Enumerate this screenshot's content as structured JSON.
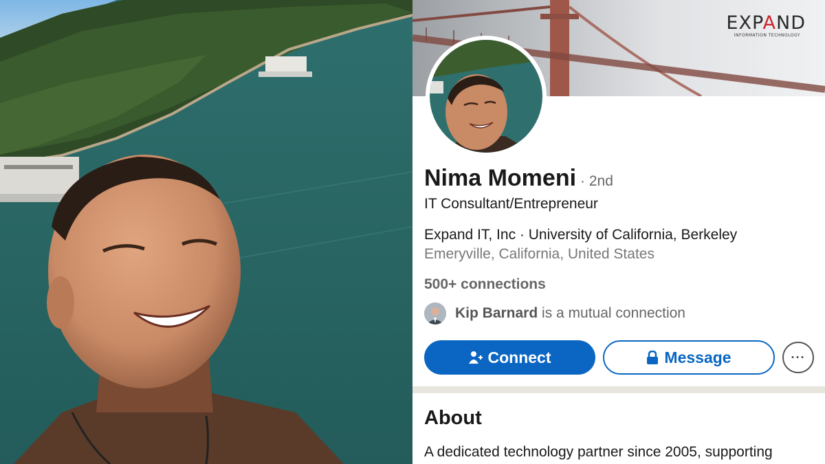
{
  "cover": {
    "brand_main": "EXPAND",
    "brand_sub": "INFORMATION TECHNOLOGY"
  },
  "profile": {
    "name": "Nima Momeni",
    "degree": "· 2nd",
    "headline": "IT Consultant/Entrepreneur",
    "company_line": "Expand IT, Inc · University of California, Berkeley",
    "location": "Emeryville, California, United States",
    "connections": "500+ connections",
    "mutual_name": "Kip Barnard",
    "mutual_suffix": " is a mutual connection"
  },
  "actions": {
    "connect_label": "Connect",
    "message_label": "Message",
    "more_label": "···"
  },
  "about": {
    "title": "About",
    "text": "A dedicated technology partner since 2005, supporting"
  },
  "colors": {
    "primary": "#0a66c2",
    "text": "#191919",
    "muted": "#666666",
    "brand_red": "#c9252c"
  }
}
